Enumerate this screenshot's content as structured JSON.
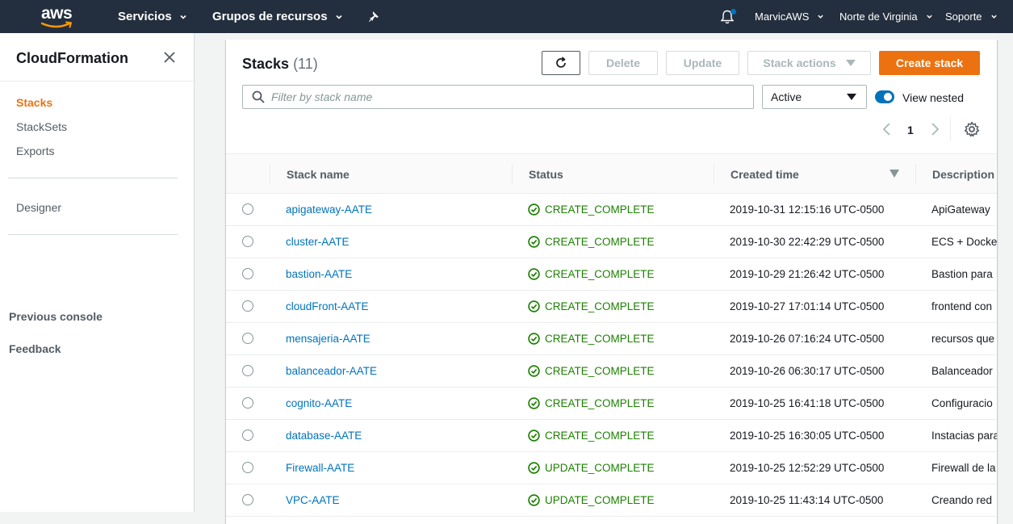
{
  "topnav": {
    "logo_text": "aws",
    "services_label": "Servicios",
    "resource_groups_label": "Grupos de recursos",
    "account_label": "MarvicAWS",
    "region_label": "Norte de Virginia",
    "support_label": "Soporte",
    "icons": [
      "pin-icon",
      "bell-icon"
    ]
  },
  "sidebar": {
    "title": "CloudFormation",
    "items": [
      {
        "label": "Stacks",
        "active": true
      },
      {
        "label": "StackSets",
        "active": false
      },
      {
        "label": "Exports",
        "active": false
      }
    ],
    "designer_label": "Designer",
    "previous_console_label": "Previous console",
    "feedback_label": "Feedback"
  },
  "header": {
    "title": "Stacks",
    "count": "(11)",
    "buttons": {
      "delete": "Delete",
      "update": "Update",
      "stack_actions": "Stack actions",
      "create_stack": "Create stack"
    }
  },
  "filters": {
    "search_placeholder": "Filter by stack name",
    "status_select": "Active",
    "view_nested_label": "View nested",
    "view_nested_on": true
  },
  "pagination": {
    "current_page": "1"
  },
  "table": {
    "columns": [
      "Stack name",
      "Status",
      "Created time",
      "Description"
    ],
    "rows": [
      {
        "name": "apigateway-AATE",
        "status": "CREATE_COMPLETE",
        "created": "2019-10-31 12:15:16 UTC-0500",
        "description": "ApiGateway"
      },
      {
        "name": "cluster-AATE",
        "status": "CREATE_COMPLETE",
        "created": "2019-10-30 22:42:29 UTC-0500",
        "description": "ECS + Docker"
      },
      {
        "name": "bastion-AATE",
        "status": "CREATE_COMPLETE",
        "created": "2019-10-29 21:26:42 UTC-0500",
        "description": "Bastion para"
      },
      {
        "name": "cloudFront-AATE",
        "status": "CREATE_COMPLETE",
        "created": "2019-10-27 17:01:14 UTC-0500",
        "description": "frontend con"
      },
      {
        "name": "mensajeria-AATE",
        "status": "CREATE_COMPLETE",
        "created": "2019-10-26 07:16:24 UTC-0500",
        "description": "recursos que"
      },
      {
        "name": "balanceador-AATE",
        "status": "CREATE_COMPLETE",
        "created": "2019-10-26 06:30:17 UTC-0500",
        "description": "Balanceador"
      },
      {
        "name": "cognito-AATE",
        "status": "CREATE_COMPLETE",
        "created": "2019-10-25 16:41:18 UTC-0500",
        "description": "Configuracio"
      },
      {
        "name": "database-AATE",
        "status": "CREATE_COMPLETE",
        "created": "2019-10-25 16:30:05 UTC-0500",
        "description": "Instacias para"
      },
      {
        "name": "Firewall-AATE",
        "status": "UPDATE_COMPLETE",
        "created": "2019-10-25 12:52:29 UTC-0500",
        "description": "Firewall de la"
      },
      {
        "name": "VPC-AATE",
        "status": "UPDATE_COMPLETE",
        "created": "2019-10-25 11:43:14 UTC-0500",
        "description": "Creando red"
      }
    ]
  },
  "colors": {
    "nav_bg": "#232f3e",
    "accent_orange": "#ec7211",
    "link_blue": "#0073bb",
    "success_green": "#1d8102"
  }
}
